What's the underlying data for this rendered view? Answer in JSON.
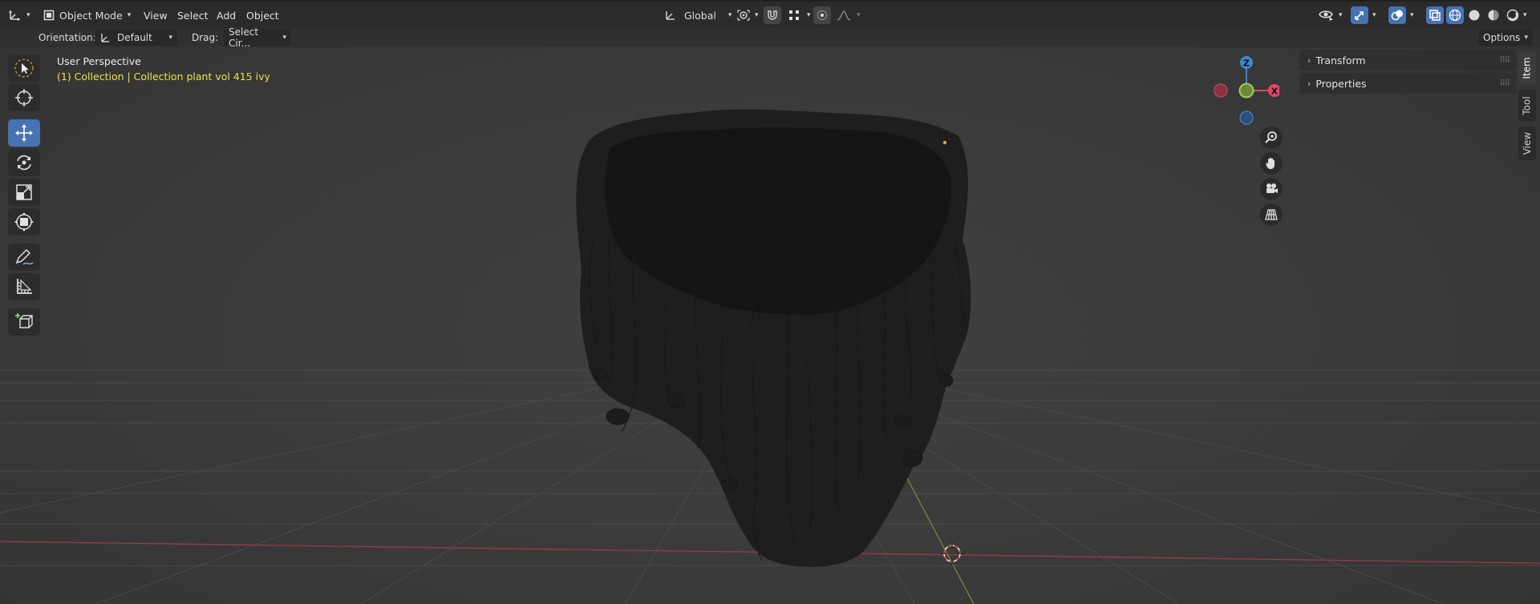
{
  "header": {
    "mode_label": "Object Mode",
    "menus": [
      "View",
      "Select",
      "Add",
      "Object"
    ],
    "transform_orientation": "Global",
    "options_label": "Options"
  },
  "tool_settings": {
    "orientation_label": "Orientation:",
    "orientation_value": "Default",
    "drag_label": "Drag:",
    "drag_value": "Select Cir..."
  },
  "toolbar": {
    "tools": [
      {
        "name": "select-tool",
        "icon": "cursor-select-icon",
        "active": false
      },
      {
        "name": "cursor-tool",
        "icon": "3d-cursor-icon",
        "active": false
      },
      {
        "name": "move-tool",
        "icon": "move-arrows-icon",
        "active": true
      },
      {
        "name": "rotate-tool",
        "icon": "rotate-icon",
        "active": false
      },
      {
        "name": "scale-tool",
        "icon": "scale-icon",
        "active": false
      },
      {
        "name": "transform-tool",
        "icon": "transform-icon",
        "active": false
      },
      {
        "name": "annotate-tool",
        "icon": "pencil-icon",
        "active": false
      },
      {
        "name": "measure-tool",
        "icon": "ruler-icon",
        "active": false
      },
      {
        "name": "add-cube-tool",
        "icon": "add-cube-icon",
        "active": false
      }
    ]
  },
  "viewport": {
    "perspective_label": "User Perspective",
    "collection_label": "(1) Collection | Collection plant vol 415 ivy"
  },
  "gizmo": {
    "z": "Z",
    "x": "X"
  },
  "npanel": {
    "sections": [
      "Transform",
      "Properties"
    ],
    "tabs": [
      "Item",
      "Tool",
      "View"
    ]
  },
  "colors": {
    "accent": "#4772b3",
    "collection_text": "#e9e24a",
    "x_axis": "#e8466a",
    "y_axis": "#8bc34a",
    "z_axis": "#3f86d4"
  }
}
